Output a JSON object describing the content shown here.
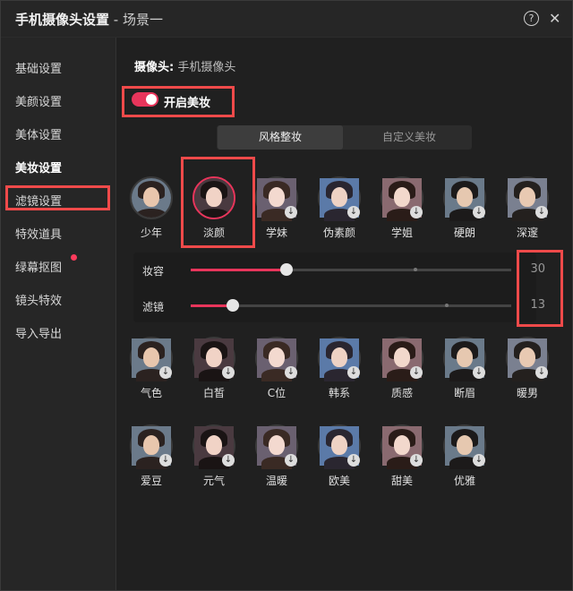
{
  "window": {
    "title": "手机摄像头设置",
    "subtitle": " - 场景一",
    "help_icon": "?",
    "close_icon": "✕"
  },
  "sidebar": {
    "items": [
      {
        "label": "基础设置"
      },
      {
        "label": "美颜设置"
      },
      {
        "label": "美体设置"
      },
      {
        "label": "美妆设置",
        "active": true
      },
      {
        "label": "滤镜设置"
      },
      {
        "label": "特效道具"
      },
      {
        "label": "绿幕抠图",
        "badge": true
      },
      {
        "label": "镜头特效"
      },
      {
        "label": "导入导出"
      }
    ]
  },
  "camera": {
    "label": "摄像头:",
    "value": "手机摄像头"
  },
  "makeup_toggle": {
    "label": "开启美妆",
    "on": true
  },
  "tabs": [
    {
      "label": "风格整妆",
      "active": true
    },
    {
      "label": "自定义美妆",
      "active": false
    }
  ],
  "styles_row1": [
    {
      "name": "少年",
      "download": false,
      "selected": false
    },
    {
      "name": "淡颜",
      "download": false,
      "selected": true
    },
    {
      "name": "学妹",
      "download": true,
      "selected": false
    },
    {
      "name": "伪素颜",
      "download": true,
      "selected": false
    },
    {
      "name": "学姐",
      "download": true,
      "selected": false
    },
    {
      "name": "硬朗",
      "download": true,
      "selected": false
    },
    {
      "name": "深邃",
      "download": true,
      "selected": false
    }
  ],
  "sliders": [
    {
      "label": "妆容",
      "value": "30",
      "fraction": 0.3,
      "tick": 0.7
    },
    {
      "label": "滤镜",
      "value": "13",
      "fraction": 0.13,
      "tick": 0.8
    }
  ],
  "styles_row2": [
    {
      "name": "气色"
    },
    {
      "name": "白皙"
    },
    {
      "name": "C位"
    },
    {
      "name": "韩系"
    },
    {
      "name": "质感"
    },
    {
      "name": "断眉"
    },
    {
      "name": "暖男"
    }
  ],
  "styles_row3": [
    {
      "name": "爱豆"
    },
    {
      "name": "元气"
    },
    {
      "name": "温暖"
    },
    {
      "name": "欧美"
    },
    {
      "name": "甜美"
    },
    {
      "name": "优雅"
    }
  ],
  "colors": {
    "accent": "#e8355b",
    "highlight": "#ef4a4a",
    "bg": "#202020"
  },
  "icons": {
    "download": "download-icon"
  }
}
